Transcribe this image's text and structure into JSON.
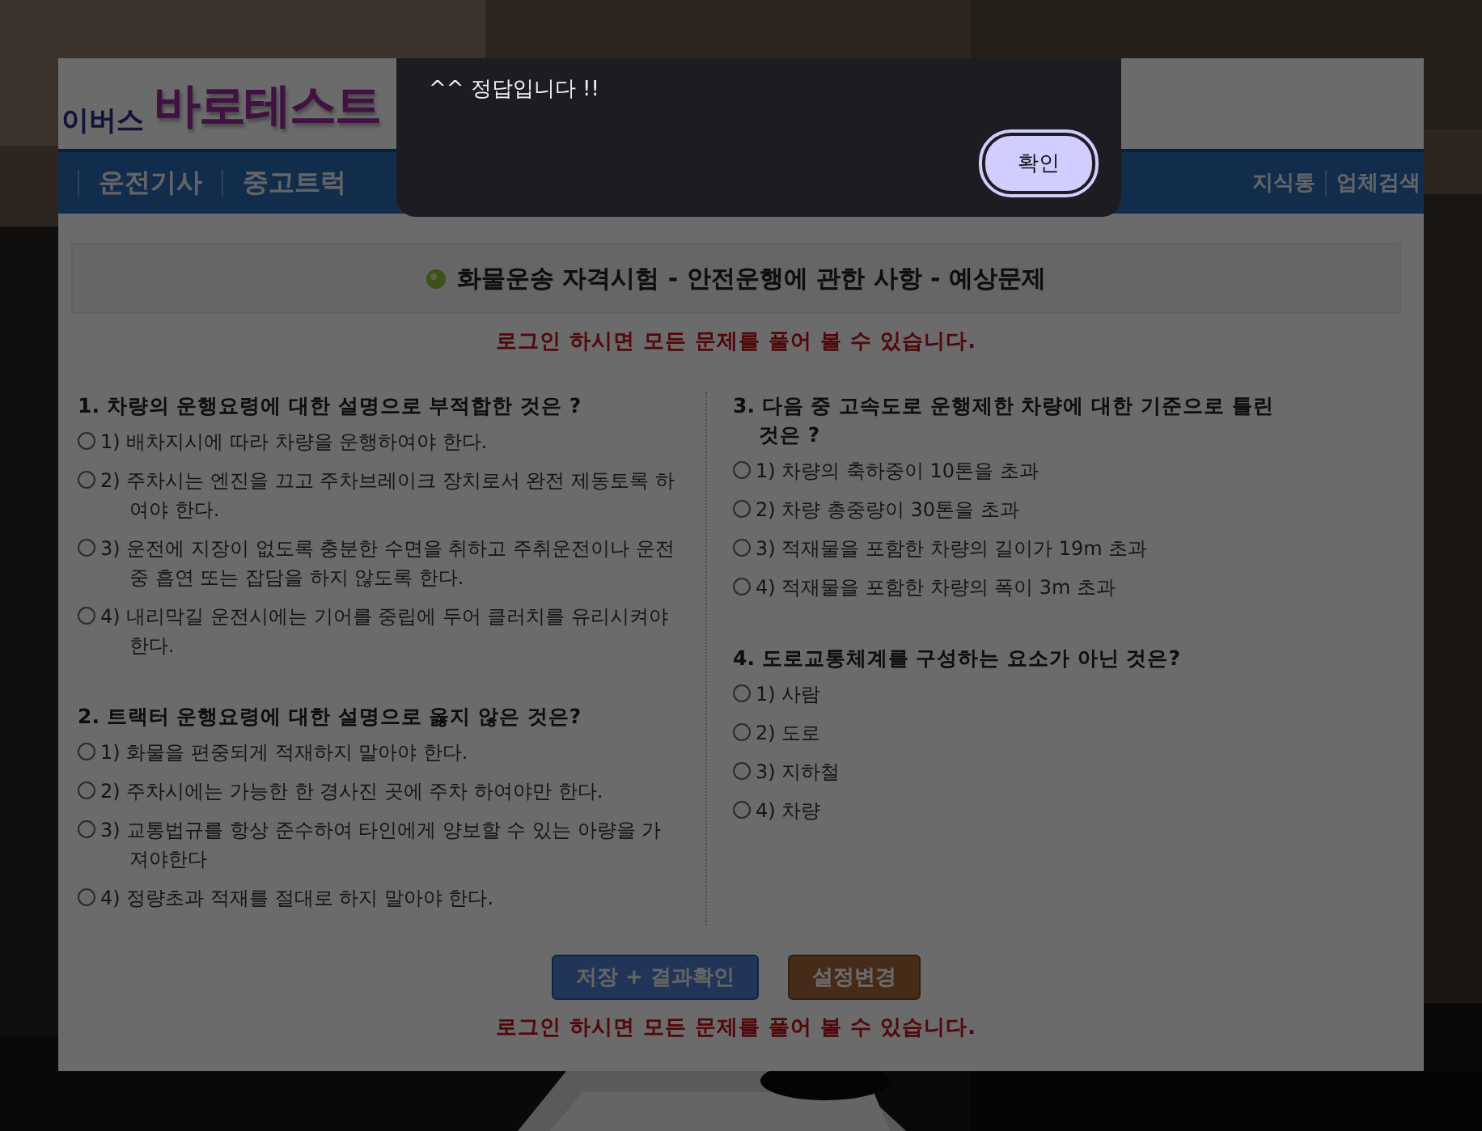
{
  "logo": {
    "prefix": "이버스",
    "name": "바로테스트"
  },
  "nav": {
    "left": [
      "운전기사",
      "중고트럭"
    ],
    "right": [
      "지식통",
      "업체검색"
    ]
  },
  "title": "화물운송 자격시험 - 안전운행에 관한 사항 - 예상문제",
  "notice_top": "로그인 하시면 모든 문제를 풀어 볼 수 있습니다.",
  "columns": [
    {
      "questions": [
        {
          "text": "1. 차량의 운행요령에 대한 설명으로 부적합한 것은 ?",
          "options": [
            {
              "label": "1) 배차지시에 따라 차량을 운행하여야 한다.",
              "selected": false
            },
            {
              "label": "2) 주차시는 엔진을 끄고 주차브레이크 장치로서 완전 제동토록 하여야 한다.",
              "selected": false
            },
            {
              "label": "3) 운전에 지장이 없도록 충분한 수면을 취하고 주취운전이나 운전중 흡연 또는 잡담을 하지 않도록 한다.",
              "selected": false
            },
            {
              "label": "4) 내리막길 운전시에는 기어를 중립에 두어 클러치를 유리시켜야 한다.",
              "selected": false
            }
          ]
        },
        {
          "text": "2. 트랙터 운행요령에 대한 설명으로 옳지 않은 것은?",
          "options": [
            {
              "label": "1) 화물을 편중되게 적재하지 말아야 한다.",
              "selected": false
            },
            {
              "label": "2) 주차시에는 가능한 한 경사진 곳에 주차 하여야만 한다.",
              "selected": false
            },
            {
              "label": "3) 교통법규를 항상 준수하여 타인에게 양보할 수 있는 아량을 가져야한다",
              "selected": false
            },
            {
              "label": "4) 정량초과 적재를 절대로 하지 말아야 한다.",
              "selected": false
            }
          ]
        }
      ]
    },
    {
      "questions": [
        {
          "text": "3. 다음 중 고속도로 운행제한 차량에 대한 기준으로 틀린 것은 ?",
          "options": [
            {
              "label": "1) 차량의 축하중이 10톤을 초과",
              "selected": false
            },
            {
              "label": "2) 차량 총중량이 30톤을 초과",
              "selected": false
            },
            {
              "label": "3) 적재물을 포함한 차량의 길이가 19m 초과",
              "selected": false
            },
            {
              "label": "4) 적재물을 포함한 차량의 폭이 3m 초과",
              "selected": false
            }
          ]
        },
        {
          "text": "4. 도로교통체계를 구성하는 요소가 아닌 것은?",
          "options": [
            {
              "label": "1) 사람",
              "selected": false
            },
            {
              "label": "2) 도로",
              "selected": false
            },
            {
              "label": "3) 지하철",
              "selected": false
            },
            {
              "label": "4) 차량",
              "selected": false
            }
          ]
        }
      ]
    }
  ],
  "buttons": [
    {
      "label": "저장 + 결과확인",
      "kind": "primary"
    },
    {
      "label": "설정변경",
      "kind": "secondary"
    }
  ],
  "notice_bottom": "로그인 하시면 모든 문제를 풀어 볼 수 있습니다.",
  "dialog": {
    "message": "^^ 정답입니다 !!",
    "button": "확인"
  }
}
